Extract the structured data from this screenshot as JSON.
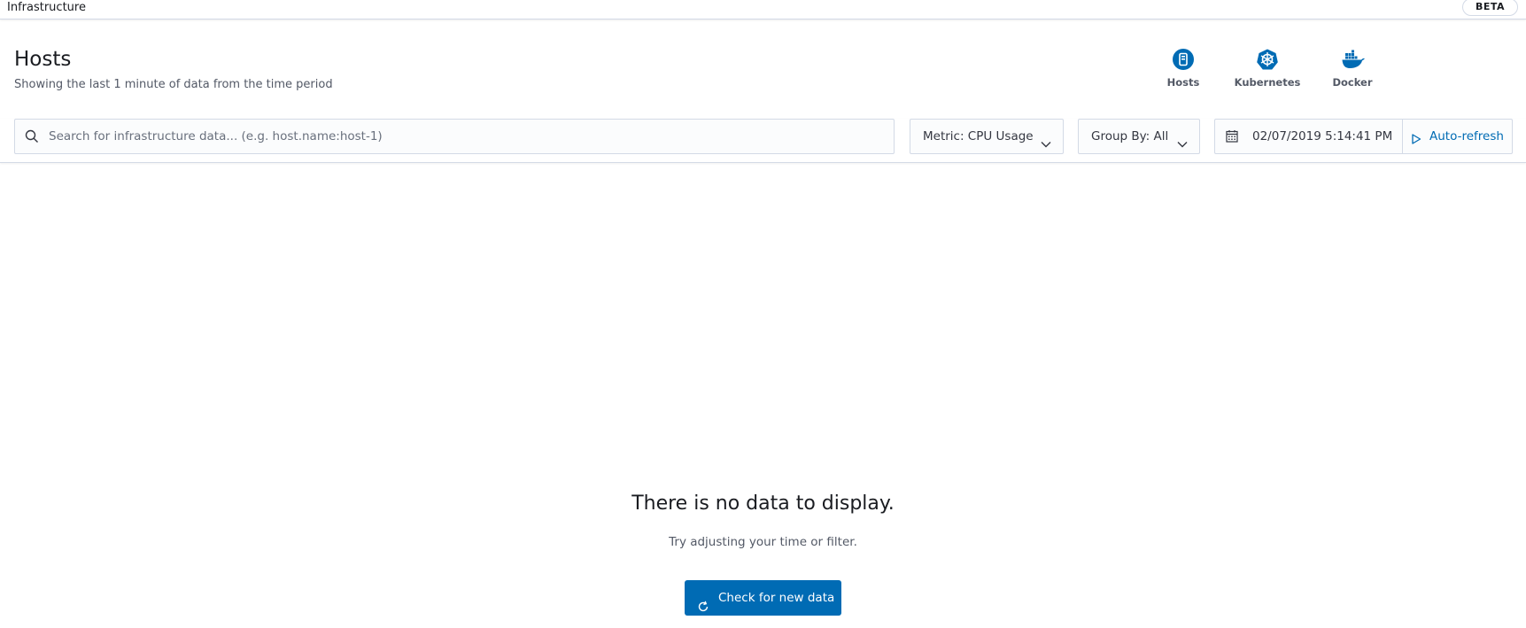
{
  "app": {
    "title": "Infrastructure",
    "badge": "BETA"
  },
  "header": {
    "title": "Hosts",
    "subtitle": "Showing the last 1 minute of data from the time period"
  },
  "node_types": [
    {
      "label": "Hosts",
      "icon": "host-icon"
    },
    {
      "label": "Kubernetes",
      "icon": "kubernetes-icon"
    },
    {
      "label": "Docker",
      "icon": "docker-icon"
    }
  ],
  "toolbar": {
    "search_placeholder": "Search for infrastructure data... (e.g. host.name:host-1)",
    "metric_label": "Metric: CPU Usage",
    "groupby_label": "Group By: All",
    "date": "02/07/2019 5:14:41 PM",
    "autorefresh_label": "Auto-refresh"
  },
  "empty_state": {
    "title": "There is no data to display.",
    "body": "Try adjusting your time or filter.",
    "button_label": "Check for new data"
  },
  "colors": {
    "accent": "#006bb4",
    "border": "#d3dae6",
    "text": "#1a1c21",
    "subdued": "#535966"
  }
}
